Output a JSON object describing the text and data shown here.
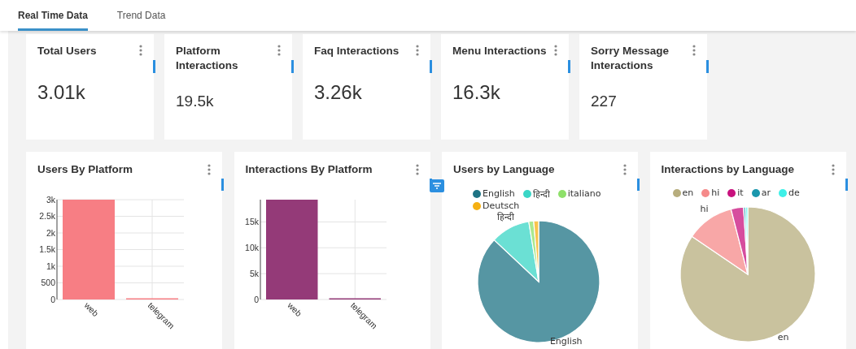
{
  "tabs": [
    {
      "label": "Real Time Data",
      "selected": true
    },
    {
      "label": "Trend Data",
      "selected": false
    }
  ],
  "stat_cards": [
    {
      "title": "Total Users",
      "value": "3.01k"
    },
    {
      "title": "Platform Interactions",
      "value": "19.5k"
    },
    {
      "title": "Faq Interactions",
      "value": "3.26k"
    },
    {
      "title": "Menu Interactions",
      "value": "16.3k"
    },
    {
      "title": "Sorry Message Interactions",
      "value": "227"
    }
  ],
  "chart_cards": [
    {
      "title": "Users By Platform",
      "chart_data": {
        "type": "bar",
        "categories": [
          "web",
          "telegram"
        ],
        "ylim": [
          0,
          3000
        ],
        "grid": true,
        "yticks": [
          {
            "value": 0,
            "label": "0"
          },
          {
            "value": 500,
            "label": "500"
          },
          {
            "value": 1000,
            "label": "1k"
          },
          {
            "value": 1500,
            "label": "1.5k"
          },
          {
            "value": 2000,
            "label": "2k"
          },
          {
            "value": 2500,
            "label": "2.5k"
          },
          {
            "value": 3000,
            "label": "3k"
          }
        ],
        "series": [
          {
            "color": "#f77e84",
            "values": [
              3000,
              20
            ]
          }
        ]
      }
    },
    {
      "title": "Interactions By Platform",
      "chart_data": {
        "type": "bar",
        "categories": [
          "web",
          "telegram"
        ],
        "ylim": [
          0,
          19300
        ],
        "grid": true,
        "yticks": [
          {
            "value": 0,
            "label": "0"
          },
          {
            "value": 5000,
            "label": "5k"
          },
          {
            "value": 10000,
            "label": "10k"
          },
          {
            "value": 15000,
            "label": "15k"
          }
        ],
        "series": [
          {
            "color": "#943a78",
            "values": [
              19300,
              200
            ]
          }
        ]
      }
    },
    {
      "title": "Users by Language",
      "legend": [
        {
          "color": "#1e7384"
        },
        {
          "color": "#3ad6c6"
        },
        {
          "color": "#8ee06a"
        },
        {
          "color": "#f5b013"
        }
      ],
      "chart_data": {
        "type": "pie",
        "categories": [
          "English",
          "हिन्दी",
          "italiano",
          "Deutsch"
        ],
        "series": [
          {
            "values": [
              87,
              10.4,
              1.3,
              1.3
            ]
          }
        ],
        "annotations": [
          {
            "text": "English",
            "x": "English"
          },
          {
            "text": "हिन्दी",
            "x": "हिन्दी"
          }
        ]
      }
    },
    {
      "title": "Interactions by Language",
      "legend": [
        {
          "color": "#b7ad7d"
        },
        {
          "color": "#f58a8a"
        },
        {
          "color": "#c8127e"
        },
        {
          "color": "#1a97ad"
        },
        {
          "color": "#3ef0e8"
        }
      ],
      "chart_data": {
        "type": "pie",
        "categories": [
          "en",
          "hi",
          "it",
          "ar",
          "de"
        ],
        "series": [
          {
            "values": [
              84.5,
              11.5,
              3,
              0.5,
              0.5
            ]
          }
        ],
        "annotations": [
          {
            "text": "en",
            "x": "en"
          },
          {
            "text": "hi",
            "x": "hi"
          }
        ]
      }
    }
  ]
}
